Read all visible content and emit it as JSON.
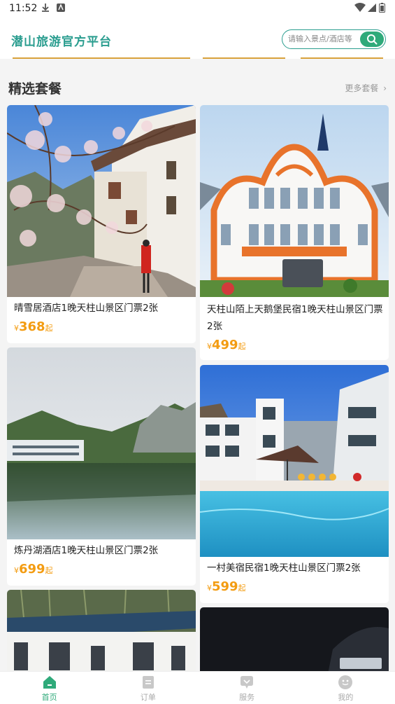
{
  "status_bar": {
    "time": "11:52"
  },
  "header": {
    "title": "潜山旅游官方平台",
    "search_placeholder": "请输入景点/酒店等"
  },
  "section": {
    "title": "精选套餐",
    "more_label": "更多套餐"
  },
  "packages": [
    {
      "name": "晴雪居酒店1晚天柱山景区门票2张",
      "price_symbol": "¥",
      "price": "368",
      "price_unit": "起"
    },
    {
      "name": "天柱山陌上天鹅堡民宿1晚天柱山景区门票2张",
      "price_symbol": "¥",
      "price": "499",
      "price_unit": "起"
    },
    {
      "name": "炼丹湖酒店1晚天柱山景区门票2张",
      "price_symbol": "¥",
      "price": "699",
      "price_unit": "起"
    },
    {
      "name": "一村美宿民宿1晚天柱山景区门票2张",
      "price_symbol": "¥",
      "price": "599",
      "price_unit": "起"
    }
  ],
  "bottom_nav": [
    {
      "label": "首页",
      "icon": "home-icon",
      "active": true
    },
    {
      "label": "订单",
      "icon": "order-icon",
      "active": false
    },
    {
      "label": "服务",
      "icon": "service-icon",
      "active": false
    },
    {
      "label": "我的",
      "icon": "profile-icon",
      "active": false
    }
  ],
  "colors": {
    "brand": "#2a9d8f",
    "accent_green": "#2faa7a",
    "price": "#f39c12"
  }
}
